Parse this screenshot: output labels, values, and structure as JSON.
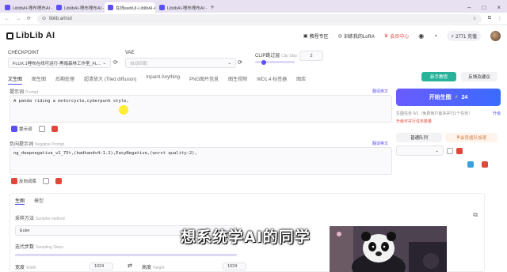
{
  "browser": {
    "tabs": [
      {
        "title": "LiblibAI-哩布哩布AI - 中国领先"
      },
      {
        "title": "LiblibAI-哩布哩布AI - 中国领先"
      },
      {
        "title": "在线webUI-LiblibAI-AI绘图工具"
      },
      {
        "title": "LiblibAI-哩布哩布AI - 中国领先"
      }
    ],
    "url": "liblib.art/sd"
  },
  "topnav": {
    "logo": "LibLib AI",
    "tutorial": "教程专区",
    "train_lora": "训练我的LoRA",
    "member": "会员中心",
    "points": "2771 充值"
  },
  "model": {
    "checkpoint_label": "CHECKPOINT",
    "checkpoint_value": "FLUX.1哩布在线可运行-黑暗森林工作室_FL...",
    "vae_label": "VAE",
    "vae_value": "自动匹配",
    "clip_label": "CLIP跳过层",
    "clip_sub": "Clip Skip",
    "clip_value": "2"
  },
  "func_tabs": [
    "文生图",
    "图生图",
    "后期处理",
    "超清放大 (Tiled diffusion)",
    "Inpaint Anything",
    "PNG图片信息",
    "图生视频",
    "WD1.4 标签器",
    "图库"
  ],
  "prompt": {
    "label": "提示词",
    "sublabel": "Prompt",
    "translate": "翻译英文",
    "value": "A panda riding a motorcycle,cyberpunk style,",
    "button": "提示词"
  },
  "negative": {
    "label": "负向提示词",
    "sublabel": "Negative Prompt",
    "translate": "翻译英文",
    "value": "ng_deepnegative_v1_75t,(badhandv4:1.2),EasyNegative,(worst quality:2),",
    "button": "反向词库"
  },
  "params": {
    "tabs": [
      "生图",
      "模型"
    ],
    "sampler_label": "采样方法",
    "sampler_sub": "Sampler method",
    "sampler_value": "Euler",
    "steps_label": "迭代步数",
    "steps_sub": "Sampling Steps",
    "width_label": "宽度",
    "width_sub": "Width",
    "width_value": "1024",
    "height_label": "高度",
    "height_sub": "Height",
    "height_value": "1024"
  },
  "right": {
    "newbie": "新手教程",
    "feedback": "反馈及建议",
    "generate": "开始生图",
    "cost": "24",
    "task_line": "生图任务 0/1（免费用户最多并行1个任务）",
    "task_link": "升级",
    "upgrade_note": "升级可并行任务数量",
    "normal_queue": "普通队列",
    "vip_queue": "会员插队加速"
  },
  "caption": "想系统学AI的同学",
  "colors": {
    "accent": "#5b4ff5",
    "danger": "#e0483c"
  }
}
